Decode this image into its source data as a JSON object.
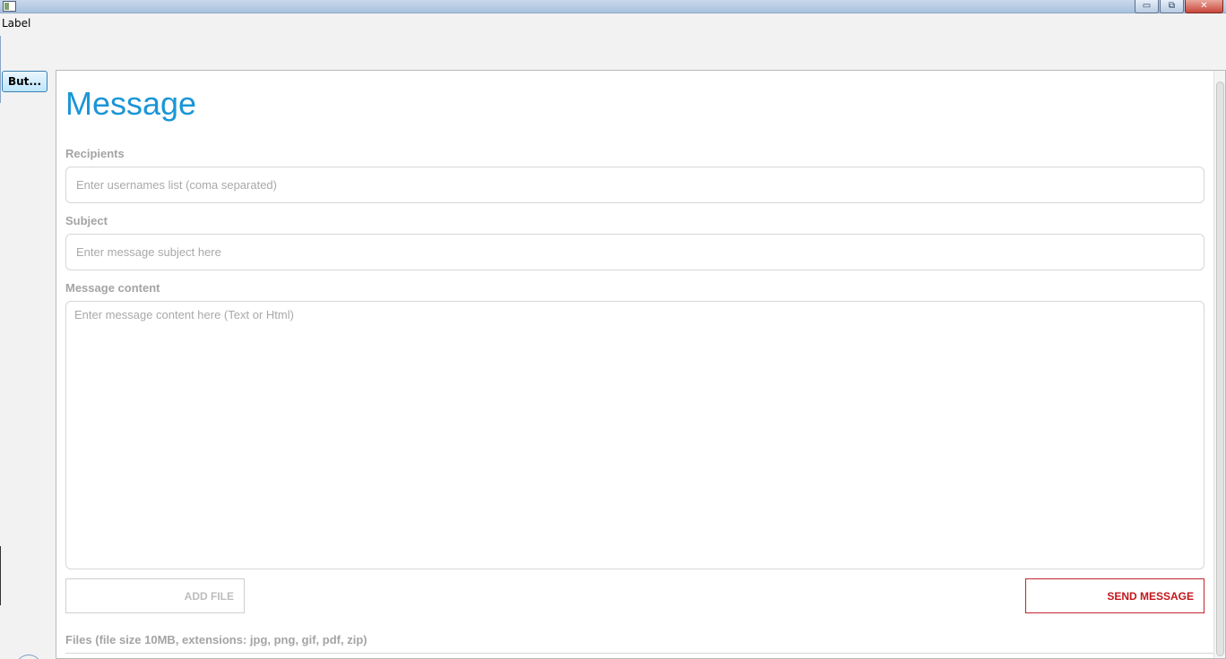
{
  "window": {
    "controls": {
      "minimize_icon": "minimize-icon",
      "restore_icon": "restore-icon",
      "close_icon": "close-icon",
      "minimize_glyph": "▭",
      "restore_glyph": "⧉",
      "close_glyph": "✕"
    }
  },
  "top_label": "Label",
  "side_button_label": "But...",
  "form": {
    "heading": "Message",
    "recipients": {
      "label": "Recipients",
      "value": "",
      "placeholder": "Enter usernames list (coma separated)"
    },
    "subject": {
      "label": "Subject",
      "value": "",
      "placeholder": "Enter message subject here"
    },
    "content": {
      "label": "Message content",
      "value": "",
      "placeholder": "Enter message content here (Text or Html)"
    },
    "add_file_label": "ADD FILE",
    "send_label": "SEND MESSAGE",
    "files_note": "Files (file  size 10MB, extensions: jpg, png, gif, pdf, zip)"
  },
  "colors": {
    "heading": "#1a96d6",
    "send_accent": "#c4161c",
    "label_gray": "#a4a4a4"
  }
}
